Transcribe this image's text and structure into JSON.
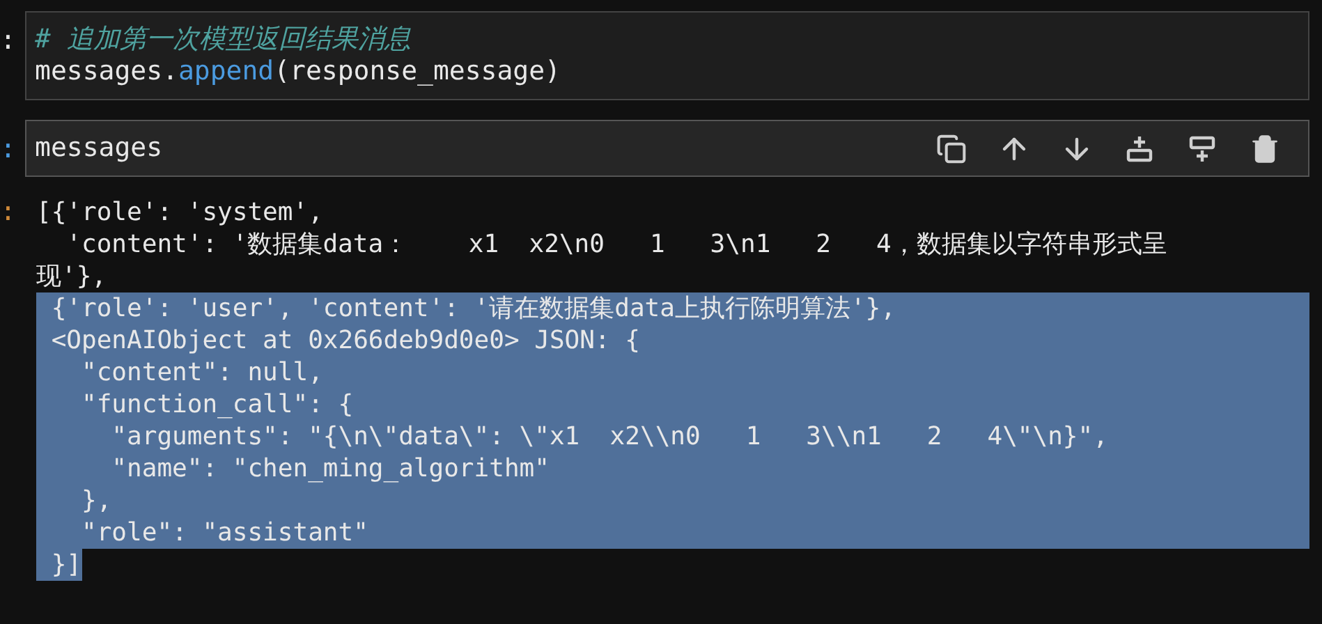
{
  "cells": [
    {
      "prompt": ":",
      "active": false,
      "lines": [
        [
          {
            "kind": "comment",
            "text": "# 追加第一次模型返回结果消息"
          }
        ],
        [
          {
            "kind": "name",
            "text": "messages."
          },
          {
            "kind": "function",
            "text": "append"
          },
          {
            "kind": "name",
            "text": "(response_message)"
          }
        ]
      ]
    },
    {
      "prompt": ":",
      "active": true,
      "lines": [
        [
          {
            "kind": "name",
            "text": "messages"
          }
        ]
      ]
    }
  ],
  "output": {
    "prompt": ":",
    "lines": [
      {
        "kind": "line",
        "selected": false,
        "text": "[{'role': 'system',"
      },
      {
        "kind": "line",
        "selected": false,
        "text": "  'content': '数据集data：    x1  x2\\n0   1   3\\n1   2   4，数据集以字符串形式呈"
      },
      {
        "kind": "line",
        "selected": false,
        "text": "现'},"
      },
      {
        "kind": "line",
        "selected": true,
        "text": " {'role': 'user', 'content': '请在数据集data上执行陈明算法'},"
      },
      {
        "kind": "line",
        "selected": true,
        "text": " <OpenAIObject at 0x266deb9d0e0> JSON: {"
      },
      {
        "kind": "line",
        "selected": true,
        "text": "   \"content\": null,"
      },
      {
        "kind": "line",
        "selected": true,
        "text": "   \"function_call\": {"
      },
      {
        "kind": "line",
        "selected": true,
        "text": "     \"arguments\": \"{\\n\\\"data\\\": \\\"x1  x2\\\\n0   1   3\\\\n1   2   4\\\"\\n}\","
      },
      {
        "kind": "line",
        "selected": true,
        "text": "     \"name\": \"chen_ming_algorithm\""
      },
      {
        "kind": "line",
        "selected": true,
        "text": "   },"
      },
      {
        "kind": "line",
        "selected": true,
        "text": "   \"role\": \"assistant\""
      },
      {
        "kind": "tail",
        "selected": true,
        "text": " }]"
      }
    ]
  }
}
